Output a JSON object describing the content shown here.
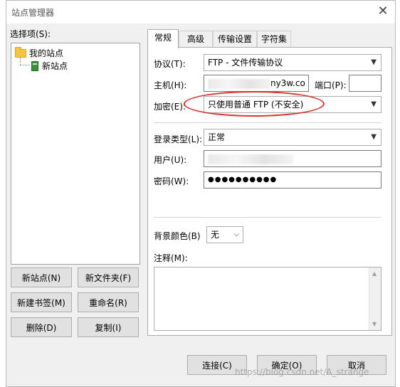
{
  "window": {
    "title": "站点管理器",
    "close_glyph": "✕"
  },
  "left": {
    "label": "选择项(S):",
    "tree": {
      "root": "我的站点",
      "child": "新站点"
    },
    "buttons": {
      "new_site": "新站点(N)",
      "new_folder": "新文件夹(F)",
      "new_bookmark": "新建书签(M)",
      "rename": "重命名(R)",
      "delete": "删除(D)",
      "copy": "复制(I)"
    }
  },
  "tabs": [
    "常规",
    "高级",
    "传输设置",
    "字符集"
  ],
  "form": {
    "protocol_label": "协议(T):",
    "protocol_value": "FTP - 文件传输协议",
    "host_label": "主机(H):",
    "host_value_visible": "ny3w.co",
    "port_label": "端口(P):",
    "port_value": "",
    "encryption_label": "加密(E):",
    "encryption_value": "只使用普通 FTP (不安全)",
    "logon_label": "登录类型(L):",
    "logon_value": "正常",
    "user_label": "用户(U):",
    "user_value": "",
    "password_label": "密码(W):",
    "password_value": "●●●●●●●●●●",
    "bg_color_label": "背景颜色(B)",
    "bg_color_value": "无",
    "notes_label": "注释(M):",
    "notes_value": ""
  },
  "footer": {
    "connect": "连接(C)",
    "ok": "确定(O)",
    "cancel": "取消"
  },
  "watermark": "https://blog.csdn.net/A_strange",
  "colors": {
    "highlight_ellipse": "#d6332f",
    "site_icon": "#3c8f3c",
    "folder": "#f5c542"
  }
}
